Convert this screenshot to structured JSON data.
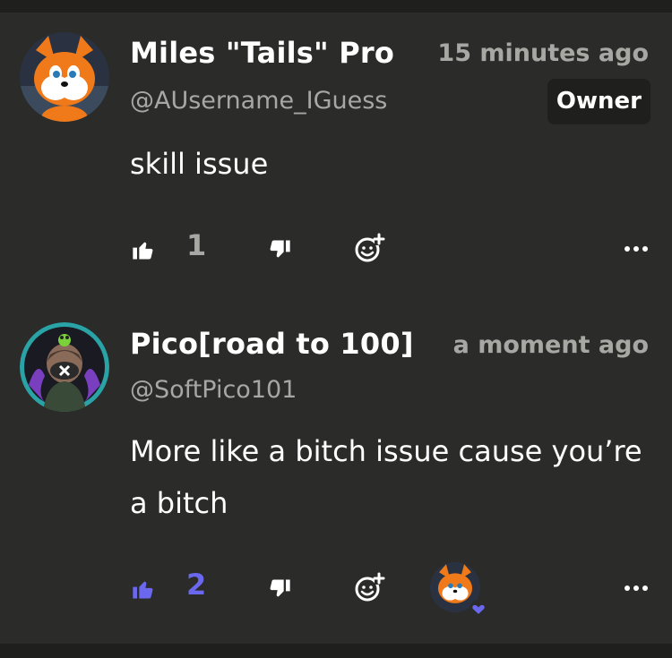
{
  "colors": {
    "background": "#2b2b29",
    "muted": "#a7a7a3",
    "accent": "#6b68f0",
    "badge_bg": "#1f1f1e"
  },
  "comments": [
    {
      "display_name": "Miles \"Tails\" Pro",
      "handle": "@AUsername_IGuess",
      "time": "15 minutes ago",
      "badge": "Owner",
      "avatar_icon": "fox-avatar-icon",
      "text": "skill issue",
      "likes": "1",
      "liked": false
    },
    {
      "display_name": "Pico[road to 100]",
      "handle": "@SoftPico101",
      "time": "a moment ago",
      "avatar_icon": "hooded-character-avatar-icon",
      "text": "More like a bitch issue cause you’re a bitch",
      "likes": "2",
      "liked": true,
      "creator_heart": true
    }
  ],
  "icons": [
    "thumbs-up-icon",
    "thumbs-down-icon",
    "add-reaction-icon",
    "more-options-icon",
    "heart-icon"
  ]
}
